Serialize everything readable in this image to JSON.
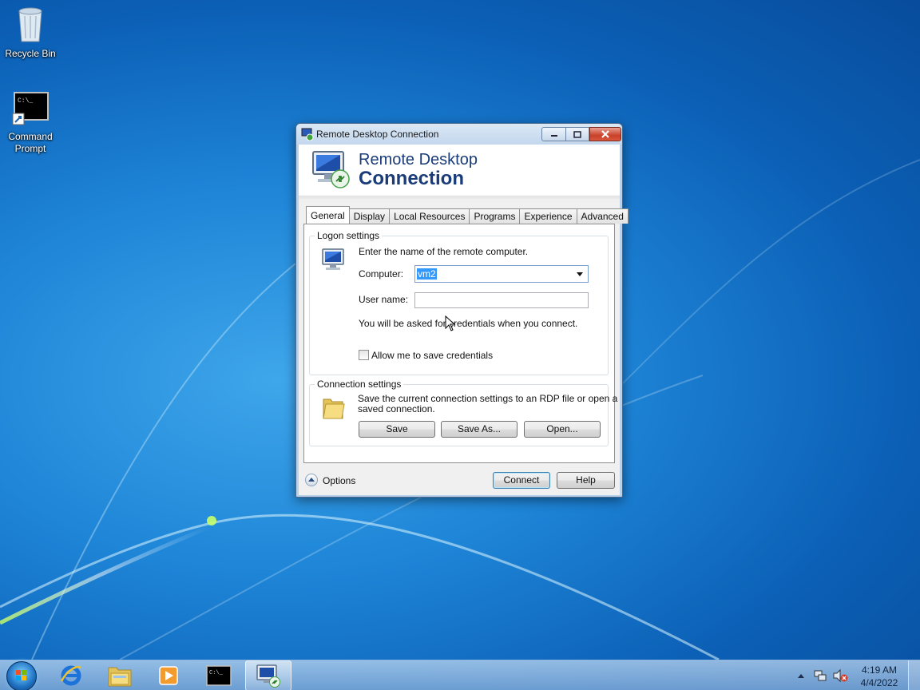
{
  "desktop": {
    "icons": [
      {
        "label": "Recycle Bin",
        "icon": "recycle-bin-icon"
      },
      {
        "label": "Command",
        "label2": "Prompt",
        "icon": "command-prompt-icon"
      }
    ]
  },
  "window": {
    "title": "Remote Desktop Connection",
    "banner_line1": "Remote Desktop",
    "banner_line2": "Connection",
    "tabs": [
      "General",
      "Display",
      "Local Resources",
      "Programs",
      "Experience",
      "Advanced"
    ],
    "active_tab": "General",
    "logon": {
      "group_label": "Logon settings",
      "instruction": "Enter the name of the remote computer.",
      "computer_label": "Computer:",
      "computer_value": "vm2",
      "username_label": "User name:",
      "username_value": "",
      "credentials_note": "You will be asked for credentials when you connect.",
      "save_credentials_label": "Allow me to save credentials",
      "save_credentials_checked": false
    },
    "connection": {
      "group_label": "Connection settings",
      "description_line1": "Save the current connection settings to an RDP file or open a",
      "description_line2": "saved connection.",
      "save_label": "Save",
      "save_as_label": "Save As...",
      "open_label": "Open..."
    },
    "options_label": "Options",
    "connect_label": "Connect",
    "help_label": "Help"
  },
  "taskbar": {
    "time": "4:19 AM",
    "date": "4/4/2022",
    "pinned": [
      "internet-explorer-icon",
      "windows-explorer-icon",
      "media-player-icon",
      "command-prompt-icon",
      "remote-desktop-icon"
    ]
  }
}
